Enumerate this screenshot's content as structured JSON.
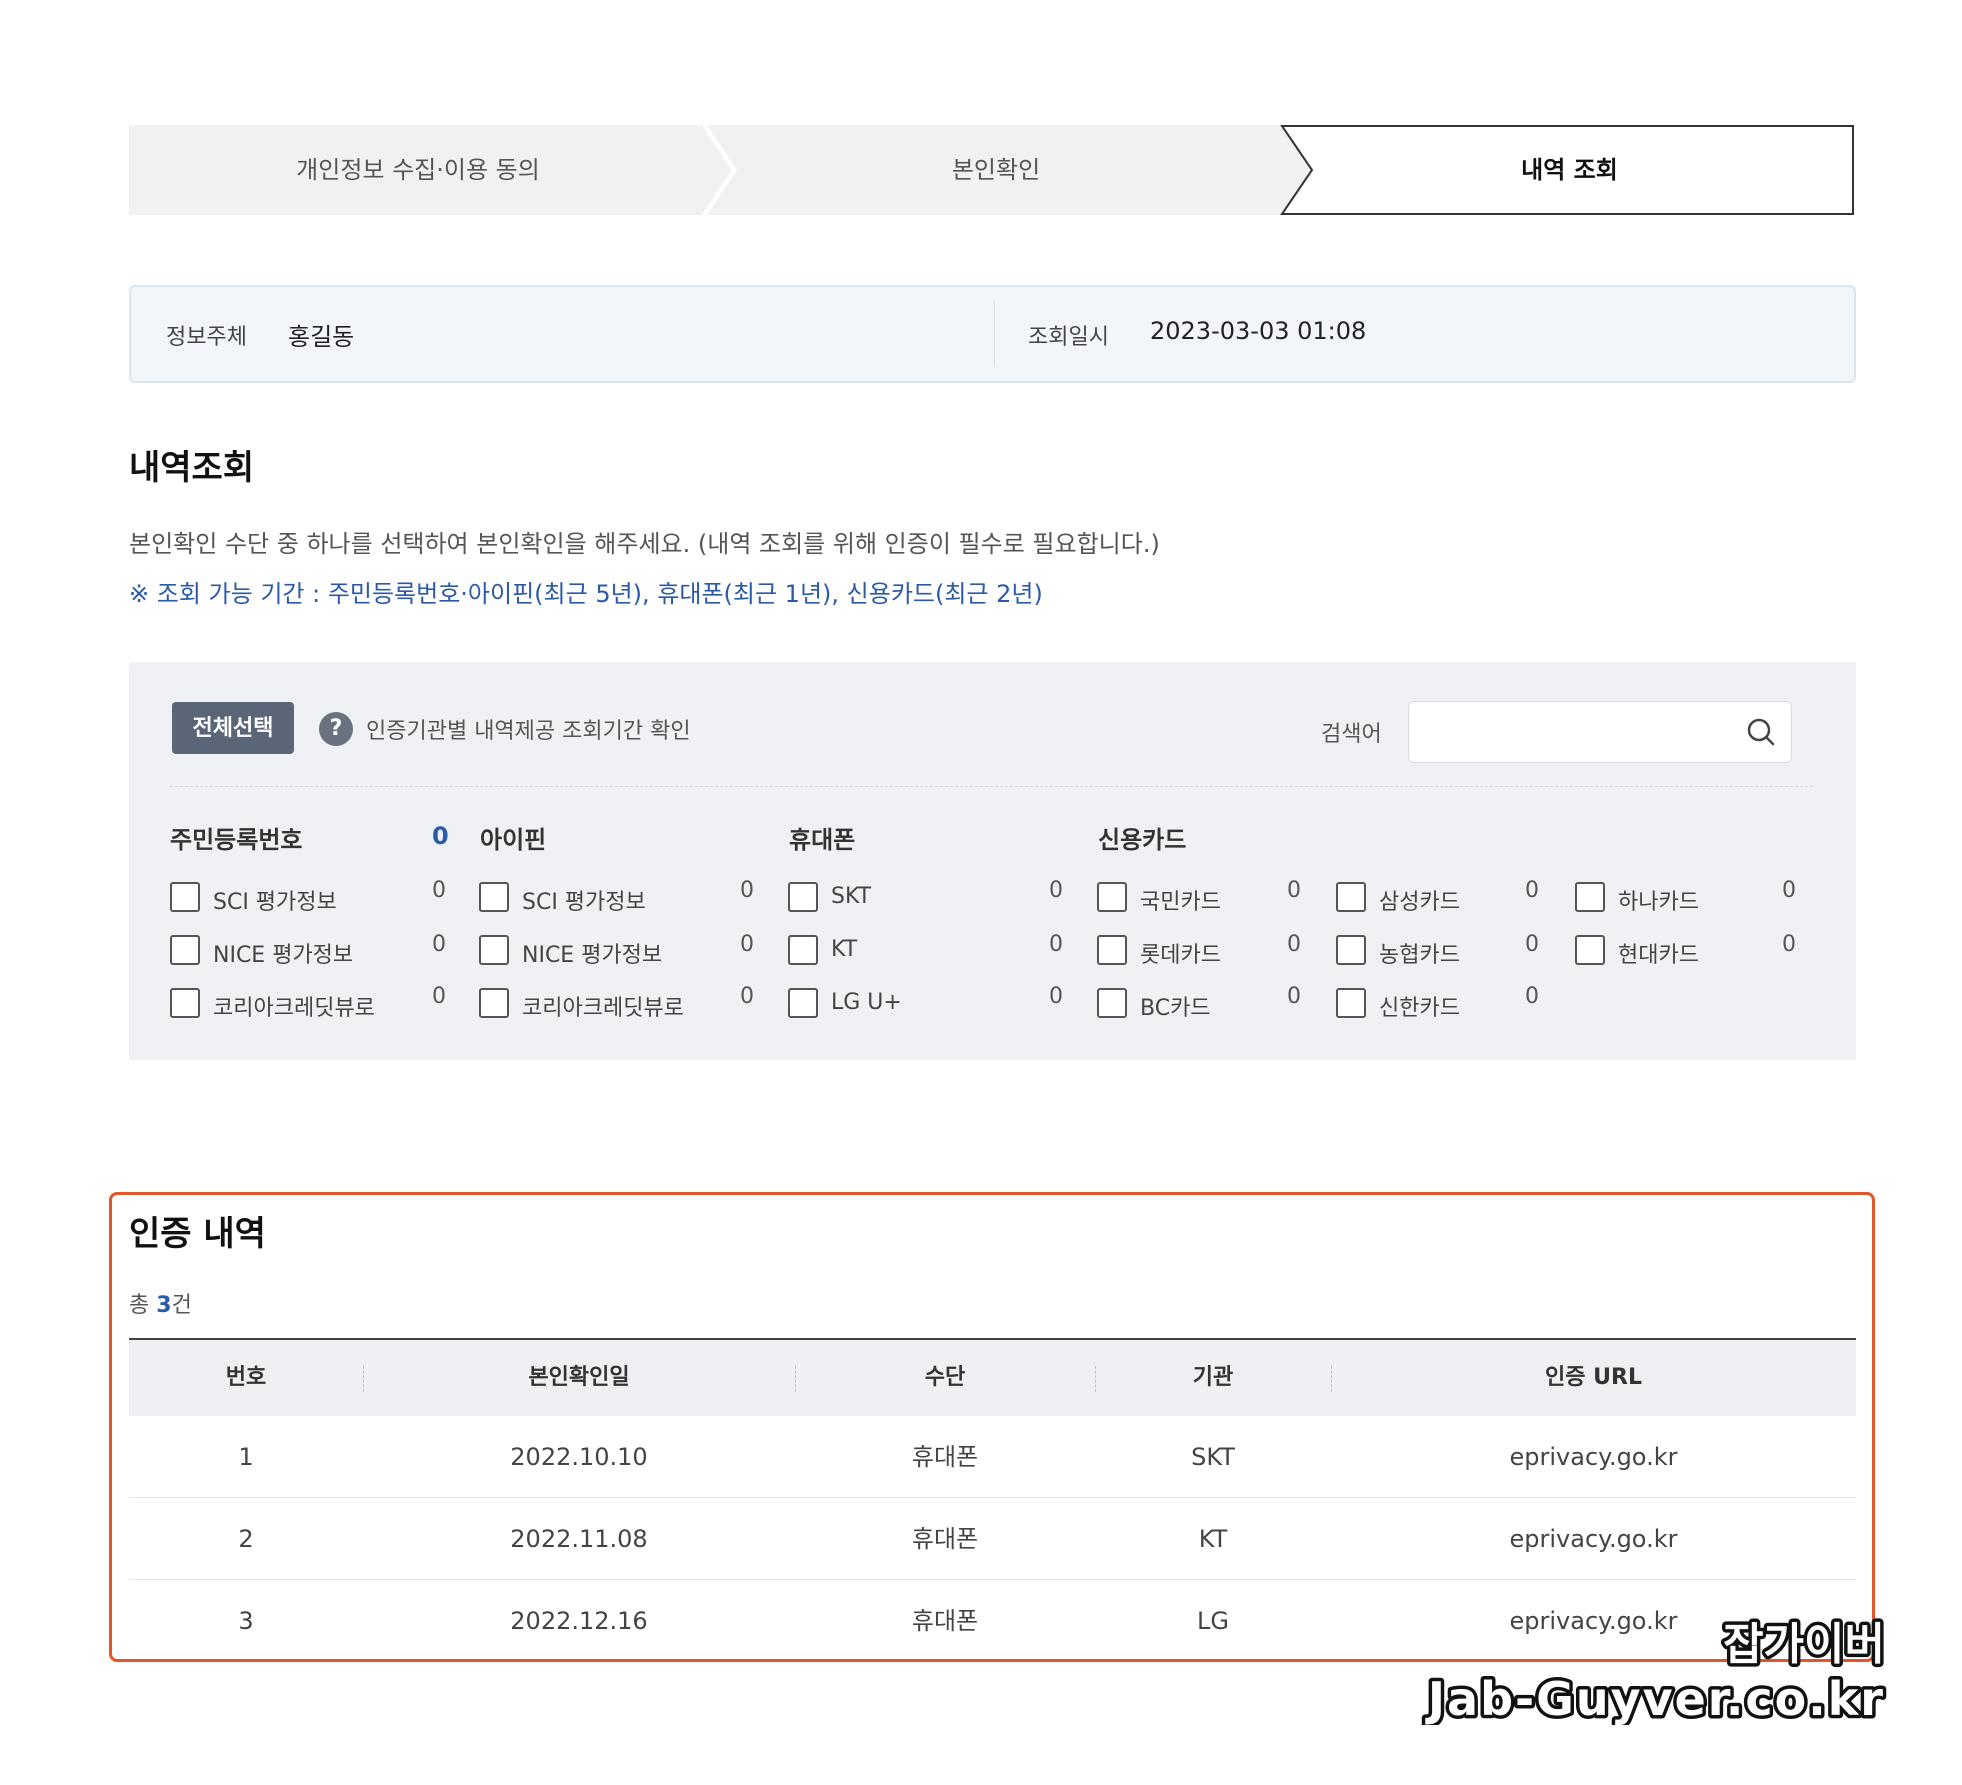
{
  "stepper": {
    "steps": [
      {
        "label": "개인정보 수집·이용 동의"
      },
      {
        "label": "본인확인"
      },
      {
        "label": "내역 조회"
      }
    ]
  },
  "info": {
    "subject_label": "정보주체",
    "subject_value": "홍길동",
    "date_label": "조회일시",
    "date_value": "2023-03-03 01:08"
  },
  "section": {
    "title": "내역조회",
    "description": "본인확인 수단 중 하나를 선택하여 본인확인을 해주세요. (내역 조회를 위해 인증이 필수로 필요합니다.)",
    "notice": "※ 조회 가능 기간 : 주민등록번호·아이핀(최근 5년), 휴대폰(최근 1년), 신용카드(최근 2년)"
  },
  "filter": {
    "select_all_label": "전체선택",
    "help_glyph": "?",
    "help_text": "인증기관별 내역제공 조회기간 확인",
    "search_label": "검색어",
    "search_value": "",
    "groups": [
      {
        "title": "주민등록번호",
        "count": "0",
        "items": [
          {
            "label": "SCI 평가정보",
            "count": "0"
          },
          {
            "label": "NICE 평가정보",
            "count": "0"
          },
          {
            "label": "코리아크레딧뷰로",
            "count": "0"
          }
        ]
      },
      {
        "title": "아이핀",
        "items": [
          {
            "label": "SCI 평가정보",
            "count": "0"
          },
          {
            "label": "NICE 평가정보",
            "count": "0"
          },
          {
            "label": "코리아크레딧뷰로",
            "count": "0"
          }
        ]
      },
      {
        "title": "휴대폰",
        "items": [
          {
            "label": "SKT",
            "count": "0"
          },
          {
            "label": "KT",
            "count": "0"
          },
          {
            "label": "LG U+",
            "count": "0"
          }
        ]
      },
      {
        "title": "신용카드",
        "items": [
          {
            "label": "국민카드",
            "count": "0"
          },
          {
            "label": "롯데카드",
            "count": "0"
          },
          {
            "label": "BC카드",
            "count": "0"
          },
          {
            "label": "삼성카드",
            "count": "0"
          },
          {
            "label": "농협카드",
            "count": "0"
          },
          {
            "label": "신한카드",
            "count": "0"
          },
          {
            "label": "하나카드",
            "count": "0"
          },
          {
            "label": "현대카드",
            "count": "0"
          }
        ]
      }
    ]
  },
  "results": {
    "title": "인증 내역",
    "total_prefix": "총",
    "total_count": "3",
    "total_suffix": "건",
    "columns": [
      "번호",
      "본인확인일",
      "수단",
      "기관",
      "인증 URL"
    ],
    "rows": [
      [
        "1",
        "2022.10.10",
        "휴대폰",
        "SKT",
        "eprivacy.go.kr"
      ],
      [
        "2",
        "2022.11.08",
        "휴대폰",
        "KT",
        "eprivacy.go.kr"
      ],
      [
        "3",
        "2022.12.16",
        "휴대폰",
        "LG",
        "eprivacy.go.kr"
      ]
    ]
  },
  "watermark": {
    "line1": "잡가이버",
    "line2": "Jab-Guyver.co.kr"
  },
  "colors": {
    "accent_blue": "#2a5aa8",
    "highlight_frame": "#e2572a",
    "select_all_bg": "#5a6578"
  }
}
